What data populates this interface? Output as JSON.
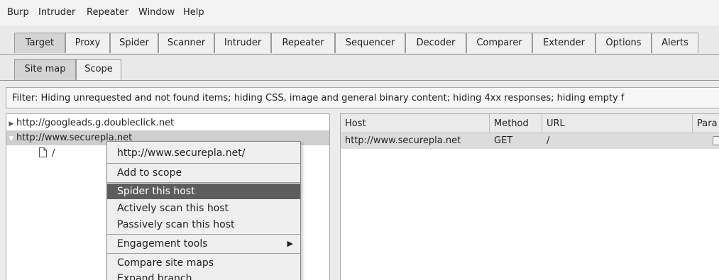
{
  "menubar": {
    "items": [
      "Burp",
      "Intruder",
      "Repeater",
      "Window",
      "Help"
    ]
  },
  "tabs": [
    {
      "label": "Target",
      "active": true
    },
    {
      "label": "Proxy"
    },
    {
      "label": "Spider"
    },
    {
      "label": "Scanner"
    },
    {
      "label": "Intruder"
    },
    {
      "label": "Repeater"
    },
    {
      "label": "Sequencer"
    },
    {
      "label": "Decoder"
    },
    {
      "label": "Comparer"
    },
    {
      "label": "Extender"
    },
    {
      "label": "Options"
    },
    {
      "label": "Alerts"
    }
  ],
  "subtabs": [
    {
      "label": "Site map",
      "active": true
    },
    {
      "label": "Scope"
    }
  ],
  "filter": {
    "text": "Filter: Hiding unrequested and not found items;  hiding CSS, image and general binary content;  hiding 4xx responses;  hiding empty f"
  },
  "tree": {
    "items": [
      {
        "label": "http://googleads.g.doubleclick.net",
        "arrow": "▶"
      },
      {
        "label": "http://www.securepla.net",
        "arrow": "▼"
      },
      {
        "label": "/",
        "icon": "file-icon"
      }
    ]
  },
  "table": {
    "columns": [
      "Host",
      "Method",
      "URL",
      "Para"
    ],
    "rows": [
      {
        "host": "http://www.securepla.net",
        "method": "GET",
        "url": "/"
      }
    ]
  },
  "context_menu": {
    "header": "http://www.securepla.net/",
    "items": [
      {
        "label": "Add to scope"
      },
      {
        "label": "Spider this host",
        "highlighted": true
      },
      {
        "label": "Actively scan this host"
      },
      {
        "label": "Passively scan this host"
      },
      {
        "label": "Engagement tools",
        "submenu": true
      },
      {
        "label": "Compare site maps"
      },
      {
        "label": "Expand branch"
      }
    ],
    "submenu_arrow": "▶"
  }
}
